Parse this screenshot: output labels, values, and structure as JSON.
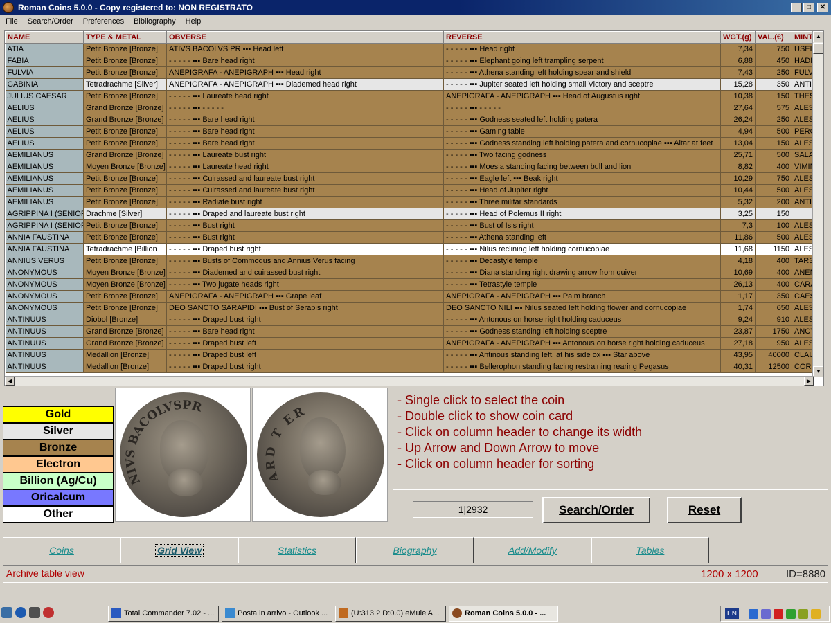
{
  "window": {
    "title": "Roman Coins 5.0.0 - Copy registered to:  NON REGISTRATO"
  },
  "menu": [
    "File",
    "Search/Order",
    "Preferences",
    "Bibliography",
    "Help"
  ],
  "grid": {
    "columns": [
      "NAME",
      "TYPE & METAL",
      "OBVERSE",
      "REVERSE",
      "WGT.(g)",
      "VAL.(€)",
      "MINT"
    ],
    "rows": [
      {
        "metal": "Bronze",
        "name": "ATIA",
        "type": "Petit Bronze [Bronze]",
        "obverse": "ATIVS BACOLVS PR ▪▪▪ Head left",
        "reverse": "- - - - - ▪▪▪ Head right",
        "wgt": "7,34",
        "val": "750",
        "mint": "USELIS"
      },
      {
        "metal": "Bronze",
        "name": "FABIA",
        "type": "Petit Bronze [Bronze]",
        "obverse": "- - - - - ▪▪▪ Bare head right",
        "reverse": "- - - - - ▪▪▪ Elephant going left trampling serpent",
        "wgt": "6,88",
        "val": "450",
        "mint": "HADRUM"
      },
      {
        "metal": "Bronze",
        "name": "FULVIA",
        "type": "Petit Bronze [Bronze]",
        "obverse": "ANEPIGRAFA - ANEPIGRAPH ▪▪▪ Head right",
        "reverse": "- - - - - ▪▪▪ Athena standing left holding spear and shield",
        "wgt": "7,43",
        "val": "250",
        "mint": "FULVIA"
      },
      {
        "metal": "Silver",
        "name": "GABINIA",
        "type": "Tetradrachme [Silver]",
        "obverse": "ANEPIGRAFA - ANEPIGRAPH ▪▪▪ Diademed head right",
        "reverse": "- - - - - ▪▪▪ Jupiter seated left holding small Victory and sceptre",
        "wgt": "15,28",
        "val": "350",
        "mint": "ANTIOCH"
      },
      {
        "metal": "Bronze",
        "name": "JULIUS CAESAR",
        "type": "Petit Bronze [Bronze]",
        "obverse": "- - - - - ▪▪▪ Laureate head right",
        "reverse": "ANEPIGRAFA - ANEPIGRAPH ▪▪▪ Head of Augustus right",
        "wgt": "10,38",
        "val": "150",
        "mint": "THESSA"
      },
      {
        "metal": "Bronze",
        "name": "AELIUS",
        "type": "Grand Bronze [Bronze]",
        "obverse": "- - - - - ▪▪▪ - - - - -",
        "reverse": "- - - - - ▪▪▪ - - - - -",
        "wgt": "27,64",
        "val": "575",
        "mint": "ALESSA"
      },
      {
        "metal": "Bronze",
        "name": "AELIUS",
        "type": "Grand Bronze [Bronze]",
        "obverse": "- - - - - ▪▪▪ Bare head right",
        "reverse": "- - - - - ▪▪▪ Godness seated left holding patera",
        "wgt": "26,24",
        "val": "250",
        "mint": "ALESSA"
      },
      {
        "metal": "Bronze",
        "name": "AELIUS",
        "type": "Petit Bronze [Bronze]",
        "obverse": "- - - - - ▪▪▪ Bare head right",
        "reverse": "- - - - - ▪▪▪ Gaming table",
        "wgt": "4,94",
        "val": "500",
        "mint": "PERGAM"
      },
      {
        "metal": "Bronze",
        "name": "AELIUS",
        "type": "Petit Bronze [Bronze]",
        "obverse": "- - - - - ▪▪▪ Bare head right",
        "reverse": "- - - - - ▪▪▪ Godness standing left holding patera and cornucopiae ▪▪▪ Altar at feet",
        "wgt": "13,04",
        "val": "150",
        "mint": "ALESSA"
      },
      {
        "metal": "Bronze",
        "name": "AEMILIANUS",
        "type": "Grand Bronze [Bronze]",
        "obverse": "- - - - - ▪▪▪ Laureate bust right",
        "reverse": "- - - - - ▪▪▪ Two facing godness",
        "wgt": "25,71",
        "val": "500",
        "mint": "SALAMIS"
      },
      {
        "metal": "Bronze",
        "name": "AEMILIANUS",
        "type": "Moyen Bronze [Bronze]",
        "obverse": "- - - - - ▪▪▪ Laureate head right",
        "reverse": "- - - - - ▪▪▪ Moesia standing facing between bull and lion",
        "wgt": "8,82",
        "val": "400",
        "mint": "VIMINA"
      },
      {
        "metal": "Bronze",
        "name": "AEMILIANUS",
        "type": "Petit Bronze [Bronze]",
        "obverse": "- - - - - ▪▪▪ Cuirassed and laureate bust right",
        "reverse": "- - - - - ▪▪▪ Eagle left ▪▪▪ Beak right",
        "wgt": "10,29",
        "val": "750",
        "mint": "ALESSA"
      },
      {
        "metal": "Bronze",
        "name": "AEMILIANUS",
        "type": "Petit Bronze [Bronze]",
        "obverse": "- - - - - ▪▪▪ Cuirassed and laureate bust right",
        "reverse": "- - - - - ▪▪▪ Head of Jupiter right",
        "wgt": "10,44",
        "val": "500",
        "mint": "ALESSA"
      },
      {
        "metal": "Bronze",
        "name": "AEMILIANUS",
        "type": "Petit Bronze [Bronze]",
        "obverse": "- - - - - ▪▪▪ Radiate bust right",
        "reverse": "- - - - - ▪▪▪ Three militar standards",
        "wgt": "5,32",
        "val": "200",
        "mint": "ANTIOC"
      },
      {
        "metal": "Silver",
        "name": "AGRIPPINA I (SENIOR)",
        "type": "Drachme [Silver]",
        "obverse": "- - - - - ▪▪▪ Draped and laureate bust right",
        "reverse": "- - - - - ▪▪▪ Head of Polemus II right",
        "wgt": "3,25",
        "val": "150",
        "mint": ""
      },
      {
        "metal": "Bronze",
        "name": "AGRIPPINA I (SENIOR)",
        "type": "Petit Bronze [Bronze]",
        "obverse": "- - - - - ▪▪▪ Bust right",
        "reverse": "- - - - - ▪▪▪ Bust of Isis right",
        "wgt": "7,3",
        "val": "100",
        "mint": "ALESSA"
      },
      {
        "metal": "Bronze",
        "name": "ANNIA FAUSTINA",
        "type": "Petit Bronze [Bronze]",
        "obverse": "- - - - - ▪▪▪ Bust right",
        "reverse": "- - - - - ▪▪▪ Athena standing left",
        "wgt": "11,86",
        "val": "500",
        "mint": "ALESSA"
      },
      {
        "metal": "Other",
        "name": "ANNIA FAUSTINA",
        "type": "Tetradrachme [Billion",
        "obverse": "- - - - - ▪▪▪ Draped bust right",
        "reverse": "- - - - - ▪▪▪ Nilus reclining left holding cornucopiae",
        "wgt": "11,68",
        "val": "1150",
        "mint": "ALESSA"
      },
      {
        "metal": "Bronze",
        "name": "ANNIUS VERUS",
        "type": "Petit Bronze [Bronze]",
        "obverse": "- - - - - ▪▪▪ Busts of Commodus and Annius Verus facing",
        "reverse": "- - - - - ▪▪▪ Decastyle temple",
        "wgt": "4,18",
        "val": "400",
        "mint": "TARSUS"
      },
      {
        "metal": "Bronze",
        "name": "ANONYMOUS",
        "type": "Moyen Bronze [Bronze]",
        "obverse": "- - - - - ▪▪▪ Diademed and cuirassed bust right",
        "reverse": "- - - - - ▪▪▪ Diana standing right drawing arrow from quiver",
        "wgt": "10,69",
        "val": "400",
        "mint": "ANEMU"
      },
      {
        "metal": "Bronze",
        "name": "ANONYMOUS",
        "type": "Moyen Bronze [Bronze]",
        "obverse": "- - - - - ▪▪▪ Two jugate heads right",
        "reverse": "- - - - - ▪▪▪ Tetrastyle temple",
        "wgt": "26,13",
        "val": "400",
        "mint": "CARAL"
      },
      {
        "metal": "Bronze",
        "name": "ANONYMOUS",
        "type": "Petit Bronze [Bronze]",
        "obverse": "ANEPIGRAFA - ANEPIGRAPH ▪▪▪ Grape leaf",
        "reverse": "ANEPIGRAFA - ANEPIGRAPH ▪▪▪ Palm branch",
        "wgt": "1,17",
        "val": "350",
        "mint": "CAESA"
      },
      {
        "metal": "Bronze",
        "name": "ANONYMOUS",
        "type": "Petit Bronze [Bronze]",
        "obverse": "DEO SANCTO SARAPIDI ▪▪▪ Bust of Serapis right",
        "reverse": "DEO SANCTO NILI ▪▪▪ Nilus seated left holding flower and cornucopiae",
        "wgt": "1,74",
        "val": "650",
        "mint": "ALESSA"
      },
      {
        "metal": "Bronze",
        "name": "ANTINUUS",
        "type": "Diobol [Bronze]",
        "obverse": "- - - - - ▪▪▪ Draped bust right",
        "reverse": "- - - - - ▪▪▪ Antonous on horse right holding caduceus",
        "wgt": "9,24",
        "val": "910",
        "mint": "ALESSA"
      },
      {
        "metal": "Bronze",
        "name": "ANTINUUS",
        "type": "Grand Bronze [Bronze]",
        "obverse": "- - - - - ▪▪▪ Bare head right",
        "reverse": "- - - - - ▪▪▪ Godness standing left holding sceptre",
        "wgt": "23,87",
        "val": "1750",
        "mint": "ANCYRA"
      },
      {
        "metal": "Bronze",
        "name": "ANTINUUS",
        "type": "Grand Bronze [Bronze]",
        "obverse": "- - - - - ▪▪▪ Draped bust left",
        "reverse": "ANEPIGRAFA - ANEPIGRAPH ▪▪▪ Antonous on horse right holding caduceus",
        "wgt": "27,18",
        "val": "950",
        "mint": "ALESSA"
      },
      {
        "metal": "Bronze",
        "name": "ANTINUUS",
        "type": "Medallion [Bronze]",
        "obverse": "- - - - - ▪▪▪ Draped bust left",
        "reverse": "- - - - - ▪▪▪ Antinous standing left, at his side ox ▪▪▪ Star above",
        "wgt": "43,95",
        "val": "40000",
        "mint": "CLAUDI"
      },
      {
        "metal": "Bronze",
        "name": "ANTINUUS",
        "type": "Medallion [Bronze]",
        "obverse": "- - - - - ▪▪▪ Draped bust right",
        "reverse": "- - - - - ▪▪▪ Bellerophon standing facing restraining rearing Pegasus",
        "wgt": "40,31",
        "val": "12500",
        "mint": "CORINT"
      }
    ]
  },
  "legend": [
    {
      "label": "Gold",
      "color": "#ffff00"
    },
    {
      "label": "Silver",
      "color": "#e6e6e6"
    },
    {
      "label": "Bronze",
      "color": "#a6834e"
    },
    {
      "label": "Electron",
      "color": "#ffc890"
    },
    {
      "label": "Billion (Ag/Cu)",
      "color": "#c8ffc8"
    },
    {
      "label": "Oricalcum",
      "color": "#7878ff"
    },
    {
      "label": "Other",
      "color": "#ffffff"
    }
  ],
  "coins": {
    "obverse_legend": "NIVS BACOLVSPR",
    "reverse_legend": "ARD T ER"
  },
  "hints": [
    "- Single click to select the coin",
    "- Double click to show coin card",
    "- Click on column header to change its width",
    "- Up Arrow and Down Arrow to move",
    "- Click on column header for sorting"
  ],
  "counter": "1|2932",
  "buttons": {
    "search": "Search/Order",
    "reset": "Reset"
  },
  "tabs": [
    "Coins",
    "Grid View",
    "Statistics",
    "Biography",
    "Add/Modify",
    "Tables"
  ],
  "active_tab": "Grid View",
  "status": {
    "left": "Archive table view",
    "size": "1200 x 1200",
    "id": "ID=8880"
  },
  "taskbar": {
    "tasks": [
      "Total Commander 7.02 - ...",
      "Posta in arrivo - Outlook ...",
      "(U:313.2 D:0.0) eMule A...",
      "Roman Coins 5.0.0 - ..."
    ],
    "lang": "EN"
  }
}
